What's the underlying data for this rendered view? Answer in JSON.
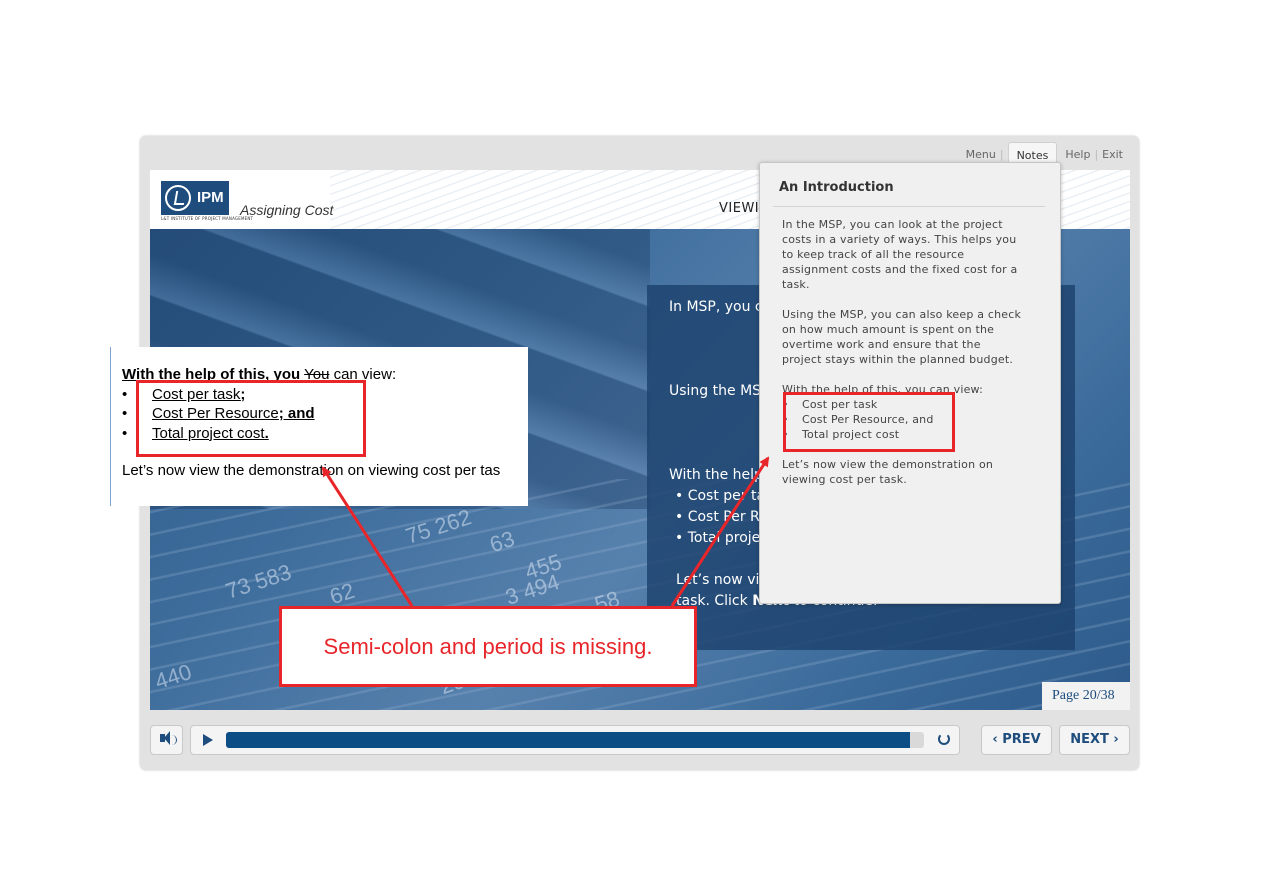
{
  "topnav": {
    "menu": "Menu",
    "notes": "Notes",
    "help": "Help",
    "exit": "Exit"
  },
  "header": {
    "logo_text": "IPM",
    "logo_sub": "L&T INSTITUTE OF PROJECT MANAGEMENT",
    "course_title": "Assigning Cost",
    "slide_title": "VIEWIN"
  },
  "slide": {
    "background_digits": [
      "75 262",
      "63",
      "455",
      "3 494",
      "73 583",
      "62",
      "58",
      "440",
      "293"
    ],
    "panel": {
      "para1": "In MSP, you c… ways. This he… assignment c…",
      "para2": "Using the MS… amount is spe… the project st…",
      "intro": "With the help",
      "bullets": [
        "Cost per ta…",
        "Cost Per R…",
        "Total proje…"
      ],
      "closing_a": "Let’s now vi…",
      "closing_b_pre": "task. Click ",
      "closing_b_bold": "Next",
      "closing_b_post": " to continue."
    },
    "page_label": "Page 20/38"
  },
  "controls": {
    "prev_label": "PREV",
    "next_label": "NEXT",
    "progress": 0.98
  },
  "notes_panel": {
    "title": "An Introduction",
    "para1": "In the MSP, you can look at the project costs in a variety of ways. This helps you to keep track of all the resource assignment costs and the fixed cost for a task.",
    "para2": "Using the MSP, you can also keep a check on how much amount is spent on the overtime work and ensure that the project stays within the planned budget.",
    "list_intro": "With the help of this, you can view:",
    "items": [
      "Cost per task",
      "Cost Per Resource, and",
      "Total project cost"
    ],
    "closing": "Let’s now view the demonstration on viewing cost per task."
  },
  "doc_overlay": {
    "intro_bold": "With the help of this, you",
    "intro_struck": "You",
    "intro_rest": "can view:",
    "items": [
      {
        "text": "Cost per task",
        "added": ";"
      },
      {
        "text": "Cost Per Resource",
        "added": "; and"
      },
      {
        "text": "Total project cost",
        "added": "."
      }
    ],
    "closing": "Let’s now view the demonstration on viewing cost per tas"
  },
  "annotation": {
    "callout": "Semi-colon and period is missing.",
    "color": "#e8262a"
  },
  "colors": {
    "brand": "#1d4c7d",
    "progress_fill": "#0b4d84"
  }
}
